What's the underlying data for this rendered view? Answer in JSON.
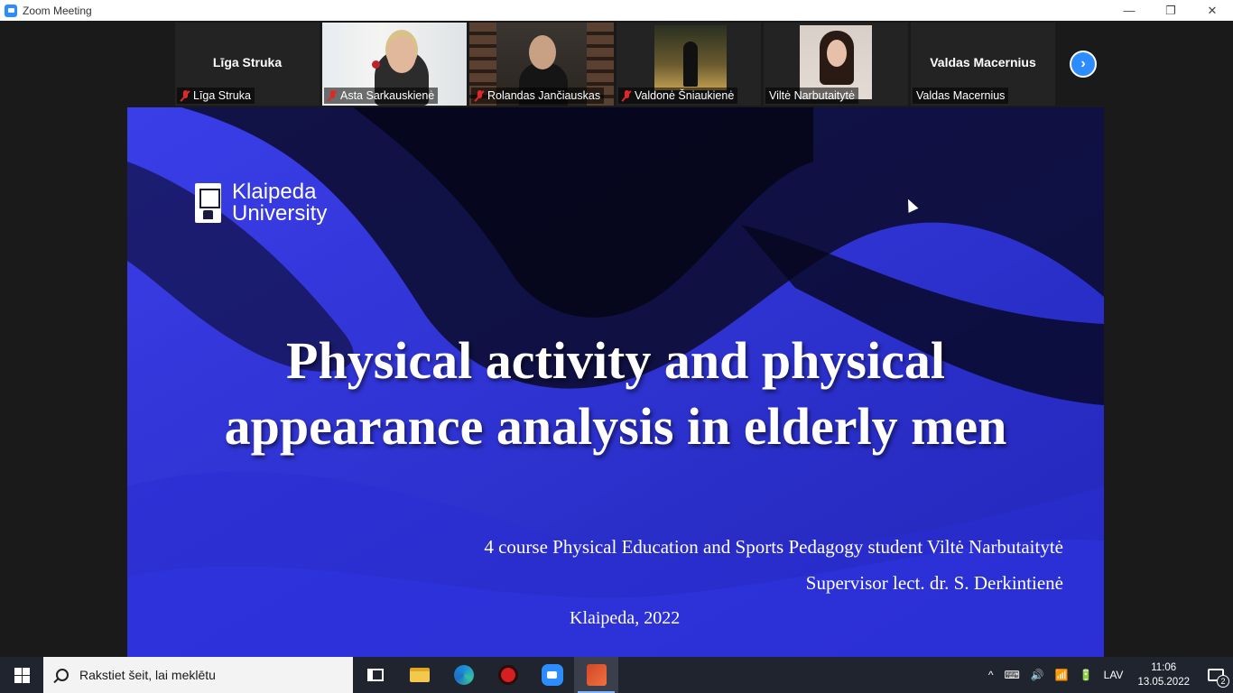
{
  "window": {
    "title": "Zoom Meeting",
    "minimize_glyph": "—",
    "restore_glyph": "❐",
    "close_glyph": "✕"
  },
  "participants": [
    {
      "name": "Līga Struka",
      "display": "Līga Struka",
      "video": false,
      "muted": true
    },
    {
      "name": "Asta Sarkauskienė",
      "video": true,
      "muted": true
    },
    {
      "name": "Rolandas Jančiauskas",
      "video": true,
      "muted": true
    },
    {
      "name": "Valdonė Šniaukienė",
      "video": true,
      "muted": true
    },
    {
      "name": "Viltė Narbutaitytė",
      "video": true,
      "muted": false,
      "active_speaker": true
    },
    {
      "name": "Valdas Macernius",
      "display": "Valdas Macernius",
      "video": false,
      "muted": false
    }
  ],
  "strip": {
    "next_glyph": "›"
  },
  "slide": {
    "logo_line1": "Klaipeda",
    "logo_line2": "University",
    "title_line1": "Physical activity and physical",
    "title_line2": "appearance analysis in elderly men",
    "subtitle1": "4 course Physical Education and Sports Pedagogy student Viltė Narbutaitytė",
    "subtitle2": "Supervisor lect. dr. S. Derkintienė",
    "footer": "Klaipeda, 2022",
    "background_color": "#2b2fd0"
  },
  "taskbar": {
    "search_placeholder": "Rakstiet šeit, lai meklētu",
    "language": "LAV",
    "time": "11:06",
    "date": "13.05.2022",
    "notifications": "2",
    "tray_glyphs": [
      "^",
      "⌨",
      "🔊",
      "📶",
      "🔋"
    ],
    "apps": [
      "task-view-icon",
      "file-explorer-icon",
      "edge-icon",
      "red-app-icon",
      "zoom-icon",
      "powerpoint-icon"
    ]
  },
  "colors": {
    "zoom_blue": "#2d8cff",
    "active_border": "#9ccc4a",
    "muted_red": "#e02828"
  }
}
